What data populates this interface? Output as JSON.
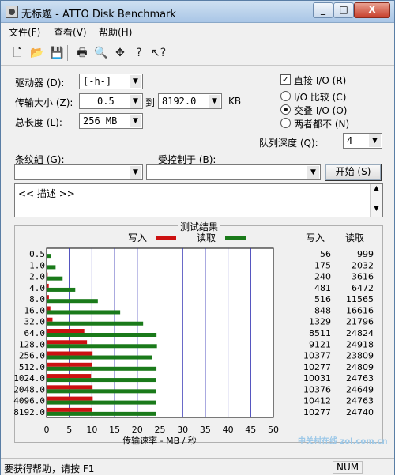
{
  "window": {
    "title": "无标题 - ATTO Disk Benchmark",
    "close": "X",
    "min": "_",
    "max": "□"
  },
  "menu": [
    "文件(F)",
    "查看(V)",
    "帮助(H)"
  ],
  "toolbar": {
    "icons": [
      "new-file-icon",
      "open-folder-icon",
      "save-icon",
      "print-icon",
      "print-preview-icon",
      "move-icon",
      "help-icon",
      "context-help-icon"
    ]
  },
  "form": {
    "drive_label": "驱动器 (D):",
    "drive_value": "[-h-]",
    "transfer_label": "传输大小 (Z):",
    "transfer_from": "0.5",
    "to_label": "到",
    "transfer_to": "8192.0",
    "kb_label": "KB",
    "length_label": "总长度 (L):",
    "length_value": "256 MB",
    "direct_io_label": "直接 I/O (R)",
    "direct_io_checked": true,
    "radio_io_compare": "I/O 比较 (C)",
    "radio_overlap": "交叠 I/O (O)",
    "radio_neither": "两者都不 (N)",
    "queue_label": "队列深度 (Q):",
    "queue_value": "4",
    "controlled_by_label": "条纹組 (G):",
    "controlled_by_value": "",
    "controlled_by2_label": "受控制于 (B):",
    "controlled_by2_value": "",
    "start_button": "开始 (S)",
    "description": "<< 描述 >>"
  },
  "chart_data": {
    "type": "bar",
    "title": "测试结果",
    "legend": [
      {
        "name": "写入",
        "color": "#cc1111"
      },
      {
        "name": "读取",
        "color": "#1a7a1a"
      }
    ],
    "categories": [
      "0.5",
      "1.0",
      "2.0",
      "4.0",
      "8.0",
      "16.0",
      "32.0",
      "64.0",
      "128.0",
      "256.0",
      "512.0",
      "1024.0",
      "2048.0",
      "4096.0",
      "8192.0"
    ],
    "series": [
      {
        "name": "写入",
        "color": "#cc1111",
        "kbs": [
          56,
          175,
          240,
          481,
          516,
          848,
          1329,
          8511,
          9121,
          10377,
          10277,
          10031,
          10376,
          10412,
          10277
        ]
      },
      {
        "name": "读取",
        "color": "#1a7a1a",
        "kbs": [
          999,
          2032,
          3616,
          6472,
          11565,
          16616,
          21796,
          24824,
          24918,
          23809,
          24809,
          24763,
          24649,
          24763,
          24740
        ]
      }
    ],
    "table_headers": [
      "写入",
      "读取"
    ],
    "xlabel": "传输速率 - MB / 秒",
    "xticks": [
      "0",
      "5",
      "10",
      "15",
      "20",
      "25",
      "30",
      "35",
      "40",
      "45",
      "50"
    ],
    "xlim": [
      0,
      50
    ],
    "grid": true
  },
  "status": {
    "text": "要获得帮助，请按 F1",
    "num": "NUM"
  },
  "watermark": "中关村在线 zol.com.cn"
}
